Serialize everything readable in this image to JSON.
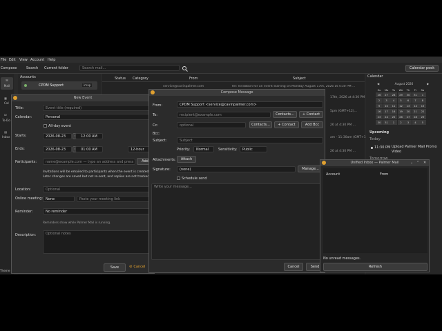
{
  "menubar": {
    "items": [
      "File",
      "Edit",
      "View",
      "Account",
      "Help"
    ]
  },
  "toolbar": {
    "compose": "Compose",
    "search_label": "Search",
    "scope": "Current folder",
    "search_placeholder": "Search mail...",
    "calendar_peek": "Calendar peek"
  },
  "sidebar": {
    "mail": "Mail",
    "cal": "Cal",
    "todo": "To-Do",
    "inbox": "Inbox",
    "theme": "Theme",
    "accounts_header": "Accounts",
    "account_name": "CPDM Support",
    "account_proto": "imap"
  },
  "maillist": {
    "columns": [
      "Status",
      "Category",
      "From",
      "Subject"
    ],
    "rows": [
      {
        "from": "service@cavinpalmer.com",
        "subject": "Re: Invitation for an event starting on Monday August 17th, 2026 at 4:30 PM ..."
      },
      {
        "from": "",
        "subject": "17th, 2026 at 4:30 PM ..."
      },
      {
        "from": "",
        "subject": "5pm (GMT+12)..."
      },
      {
        "from": "",
        "subject": "26 at 4:30 PM ..."
      },
      {
        "from": "",
        "subject": "am - 11:30am (GMT+1)..."
      },
      {
        "from": "",
        "subject": "26 at 4:30 PM ..."
      }
    ]
  },
  "calendar_panel": {
    "header": "Calendar",
    "month": "August 2026",
    "dows": [
      "Su",
      "Mo",
      "Tu",
      "We",
      "Th",
      "Fr",
      "Sa"
    ],
    "weeks": [
      [
        "26",
        "27",
        "28",
        "29",
        "30",
        "31",
        "1"
      ],
      [
        "2",
        "3",
        "4",
        "5",
        "6",
        "7",
        "8"
      ],
      [
        "9",
        "10",
        "11",
        "12",
        "13",
        "14",
        "15"
      ],
      [
        "16",
        "17",
        "18",
        "19",
        "20",
        "21",
        "22"
      ],
      [
        "23",
        "24",
        "25",
        "26",
        "27",
        "28",
        "29"
      ],
      [
        "30",
        "31",
        "1",
        "2",
        "3",
        "4",
        "5"
      ]
    ],
    "upcoming_header": "Upcoming",
    "today": "Today",
    "event_time": "11:30 PM",
    "event_title": "Upload Palmer Mail Promo Video",
    "tomorrow": "Tomorrow"
  },
  "new_event": {
    "title_bar": "New Event",
    "title_label": "Title:",
    "title_placeholder": "Event title (required)",
    "calendar_label": "Calendar:",
    "calendar_value": "Personal",
    "allday": "All-day event",
    "starts_label": "Starts:",
    "start_date": "2026-08-23",
    "start_time": "12:00 AM",
    "ends_label": "Ends:",
    "end_date": "2026-08-23",
    "end_time": "01:00 AM",
    "clock": "12-hour",
    "participants_label": "Participants:",
    "participants_placeholder": "name@example.com — type an address and press ...",
    "add": "Add",
    "info": "Invitations will be emailed to participants when the event is created. Later changes are saved but not re-sent, and replies are not tracked.",
    "location_label": "Location:",
    "location_placeholder": "Optional",
    "online_label": "Online meeting:",
    "online_value": "None",
    "online_placeholder": "Paste your meeting link",
    "reminder_label": "Reminder:",
    "reminder_value": "No reminder",
    "reminder_note": "Reminders show while Palmer Mail is running.",
    "description_label": "Description:",
    "description_placeholder": "Optional notes",
    "save": "Save",
    "cancel": "Cancel"
  },
  "compose": {
    "title_bar": "Compose Message",
    "from_label": "From:",
    "from_value": "CPDM Support <service@cavinpalmer.com>",
    "to_label": "To:",
    "to_placeholder": "recipient@example.com",
    "contacts": "Contacts...",
    "plus_contact": "+ Contact",
    "cc_label": "Cc:",
    "cc_placeholder": "optional",
    "add_bcc": "Add Bcc",
    "bcc_label": "Bcc:",
    "subject_label": "Subject:",
    "subject_placeholder": "Subject",
    "priority_label": "Priority:",
    "priority_value": "Normal",
    "sensitivity_label": "Sensitivity:",
    "sensitivity_value": "Public",
    "attachments_label": "Attachments:",
    "attach": "Attach",
    "signature_label": "Signature:",
    "signature_value": "(none)",
    "manage": "Manage...",
    "schedule": "Schedule send",
    "body_placeholder": "Write your message...",
    "cancel": "Cancel",
    "send": "Send"
  },
  "unified": {
    "title_bar": "Unified Inbox — Palmer Mail",
    "col_account": "Account",
    "col_from": "From",
    "status": "No unread messages.",
    "refresh": "Refresh"
  }
}
